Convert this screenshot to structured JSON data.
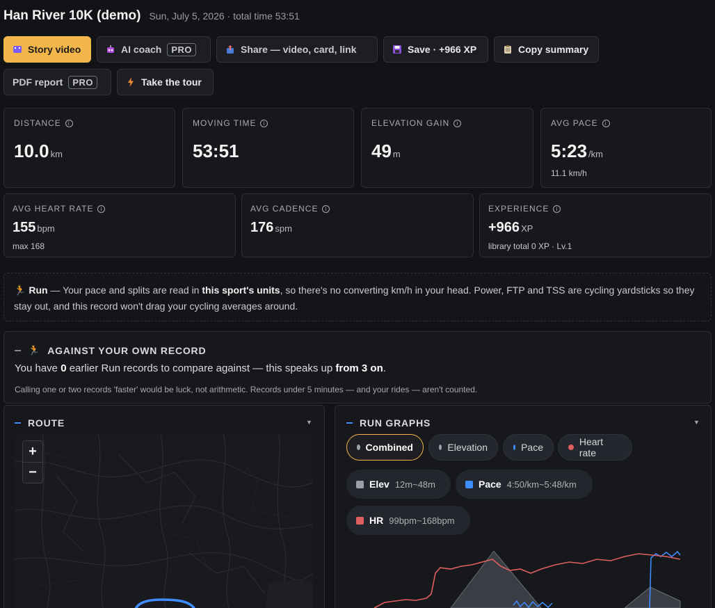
{
  "header": {
    "title": "Han River 10K (demo)",
    "subtitle": "Sun, July 5, 2026 · total time 53:51"
  },
  "toolbar": {
    "story_video": "Story video",
    "ai_coach": "AI coach",
    "pro_badge": "PRO",
    "share": "Share — video, card, link",
    "save": "Save · +966 XP",
    "copy_summary": "Copy summary",
    "pdf_report": "PDF report",
    "take_tour": "Take the tour"
  },
  "stats": {
    "distance": {
      "label": "DISTANCE",
      "value": "10.0",
      "unit": "km"
    },
    "moving_time": {
      "label": "MOVING TIME",
      "value": "53:51"
    },
    "elevation_gain": {
      "label": "ELEVATION GAIN",
      "value": "49",
      "unit": "m"
    },
    "avg_pace": {
      "label": "AVG PACE",
      "value": "5:23",
      "unit": "/km",
      "sub": "11.1 km/h"
    },
    "avg_heart_rate": {
      "label": "AVG HEART RATE",
      "value": "155",
      "unit": "bpm",
      "sub": "max 168"
    },
    "avg_cadence": {
      "label": "AVG CADENCE",
      "value": "176",
      "unit": "spm"
    },
    "experience": {
      "label": "EXPERIENCE",
      "value": "+966",
      "unit": "XP",
      "sub": "library total 0 XP · Lv.1"
    }
  },
  "note": {
    "sport": "Run",
    "text1": " — Your pace and splits are read in ",
    "bold": "this sport's units",
    "text2": ", so there's no converting km/h in your head. Power, FTP and TSS are cycling yardsticks so they stay out, and this record won't drag your cycling averages around."
  },
  "record": {
    "title": "AGAINST YOUR OWN RECORD",
    "line_pre": "You have ",
    "count": "0",
    "line_mid": " earlier Run records to compare against — this speaks up ",
    "from": "from 3 on",
    "line_end": ".",
    "footnote": "Calling one or two records 'faster' would be luck, not arithmetic. Records under 5 minutes — and your rides — aren't counted."
  },
  "route": {
    "title": "ROUTE",
    "zoom_in": "+",
    "zoom_out": "−"
  },
  "graphs": {
    "title": "RUN GRAPHS",
    "tabs": [
      "Combined",
      "Elevation",
      "Pace",
      "Heart rate"
    ],
    "legend": [
      {
        "name": "Elev",
        "range": "12m~48m",
        "color": "#9aa0aa"
      },
      {
        "name": "Pace",
        "range": "4:50/km~5:48/km",
        "color": "#3f8cff"
      },
      {
        "name": "HR",
        "range": "99bpm~168bpm",
        "color": "#e06060"
      }
    ]
  },
  "colors": {
    "accent": "#f2b64a",
    "pace": "#3f8cff",
    "hr": "#e06060",
    "elev": "#9aa0aa"
  }
}
